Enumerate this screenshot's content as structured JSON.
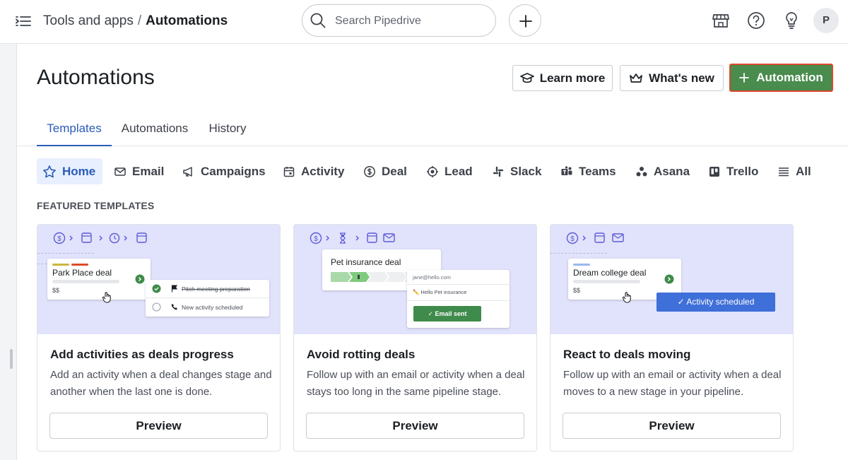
{
  "topbar": {
    "breadcrumb_parent": "Tools and apps",
    "breadcrumb_separator": "/",
    "breadcrumb_current": "Automations",
    "search_placeholder": "Search Pipedrive",
    "avatar_initial": "P"
  },
  "header": {
    "title": "Automations",
    "learn_more_label": "Learn more",
    "whats_new_label": "What's new",
    "add_automation_label": "Automation"
  },
  "tabs": [
    {
      "label": "Templates",
      "active": true
    },
    {
      "label": "Automations",
      "active": false
    },
    {
      "label": "History",
      "active": false
    }
  ],
  "categories": [
    {
      "label": "Home",
      "icon": "star-icon",
      "active": true
    },
    {
      "label": "Email",
      "icon": "mail-icon"
    },
    {
      "label": "Campaigns",
      "icon": "megaphone-icon"
    },
    {
      "label": "Activity",
      "icon": "calendar-icon"
    },
    {
      "label": "Deal",
      "icon": "dollar-icon"
    },
    {
      "label": "Lead",
      "icon": "target-icon"
    },
    {
      "label": "Slack",
      "icon": "slack-icon"
    },
    {
      "label": "Teams",
      "icon": "teams-icon"
    },
    {
      "label": "Asana",
      "icon": "asana-icon"
    },
    {
      "label": "Trello",
      "icon": "trello-icon"
    },
    {
      "label": "All",
      "icon": "list-icon"
    }
  ],
  "section_title": "FEATURED TEMPLATES",
  "cards": [
    {
      "title": "Add activities as deals progress",
      "description": "Add an activity when a deal changes stage and another when the last one is done.",
      "preview_label": "Preview",
      "art": {
        "deal_name": "Park Place deal",
        "deal_value": "$$",
        "item_1": "Pitch meeting preparation",
        "item_2": "New activity scheduled"
      }
    },
    {
      "title": "Avoid rotting deals",
      "description": "Follow up with an email or activity when a deal stays too long in the same pipeline stage.",
      "preview_label": "Preview",
      "art": {
        "deal_name": "Pet insurance deal",
        "email_to": "jane@hello.com",
        "email_body": "✏️ Hello Pet insurance",
        "email_button": "Email sent"
      }
    },
    {
      "title": "React to deals moving",
      "description": "Follow up with an email or activity when a deal moves to a new stage in your pipeline.",
      "preview_label": "Preview",
      "art": {
        "deal_name": "Dream college deal",
        "deal_value": "$$",
        "badge": "Activity scheduled"
      }
    }
  ],
  "colors": {
    "accent_blue": "#2a5cb8",
    "primary_green": "#4a8c4e",
    "highlight_border": "#e0492a",
    "art_background": "#e1e2fb",
    "activity_badge": "#3f6fd8"
  }
}
